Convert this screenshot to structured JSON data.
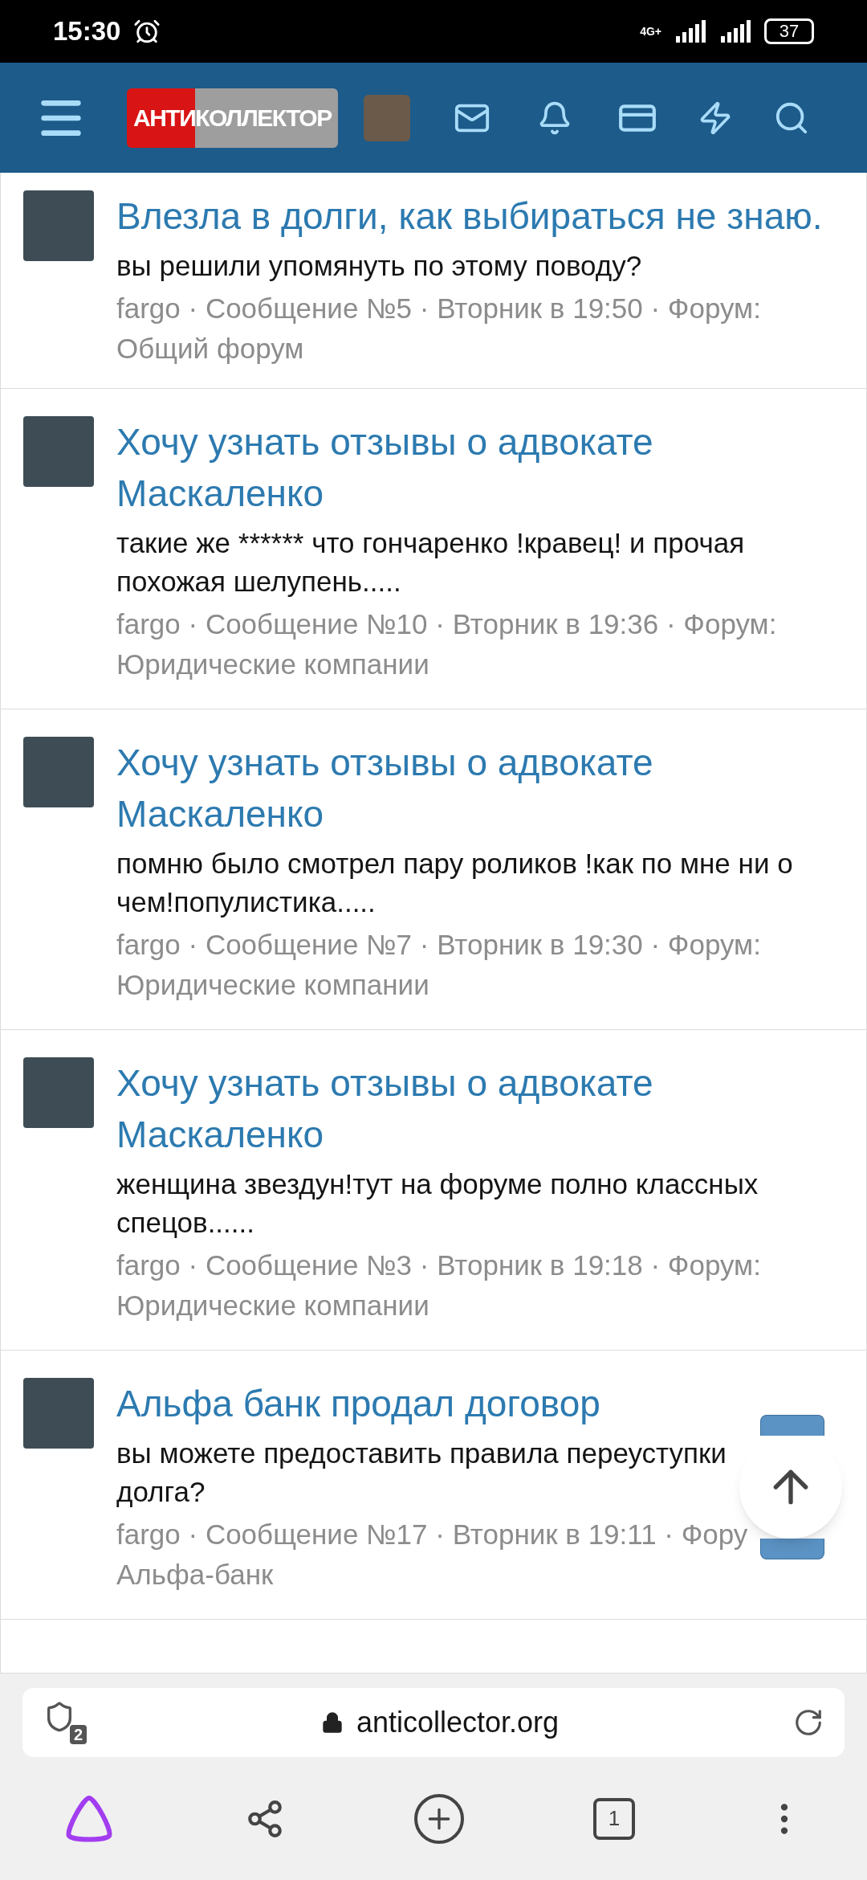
{
  "status_bar": {
    "time": "15:30",
    "network": "4G+",
    "battery": "37"
  },
  "header": {
    "logo_left": "АНТИ",
    "logo_right": "КОЛЛЕКТОР"
  },
  "posts": [
    {
      "title": "Влезла в долги, как выбираться не знаю.",
      "body": "вы решили упомянуть по этому поводу?",
      "meta_lines": [
        "fargo · Сообщение №5 · Вторник в 19:50 · Форум:",
        "Общий форум"
      ]
    },
    {
      "title": "Хочу узнать отзывы о адвокате Маскаленко",
      "body": "такие же ****** что гончаренко !кравец! и прочая похожая шелупень.....",
      "meta_lines": [
        "fargo · Сообщение №10 · Вторник в 19:36 · Форум:",
        "Юридические компании"
      ]
    },
    {
      "title": "Хочу узнать отзывы о адвокате Маскаленко",
      "body": "помню было смотрел пару роликов !как по мне ни о чем!популистика.....",
      "meta_lines": [
        "fargo · Сообщение №7 · Вторник в 19:30 · Форум:",
        "Юридические компании"
      ]
    },
    {
      "title": "Хочу узнать отзывы о адвокате Маскаленко",
      "body": "женщина звездун!тут на форуме полно классных спецов......",
      "meta_lines": [
        "fargo · Сообщение №3 · Вторник в 19:18 · Форум:",
        "Юридические компании"
      ]
    },
    {
      "title": "Альфа банк продал договор",
      "body": "вы можете предоставить правила переуступки долга?",
      "meta_lines": [
        "fargo · Сообщение №17 · Вторник в 19:11 · Фору",
        "Альфа-банк"
      ]
    }
  ],
  "browser": {
    "shield_count": "2",
    "url": "anticollector.org",
    "tab_count": "1"
  }
}
